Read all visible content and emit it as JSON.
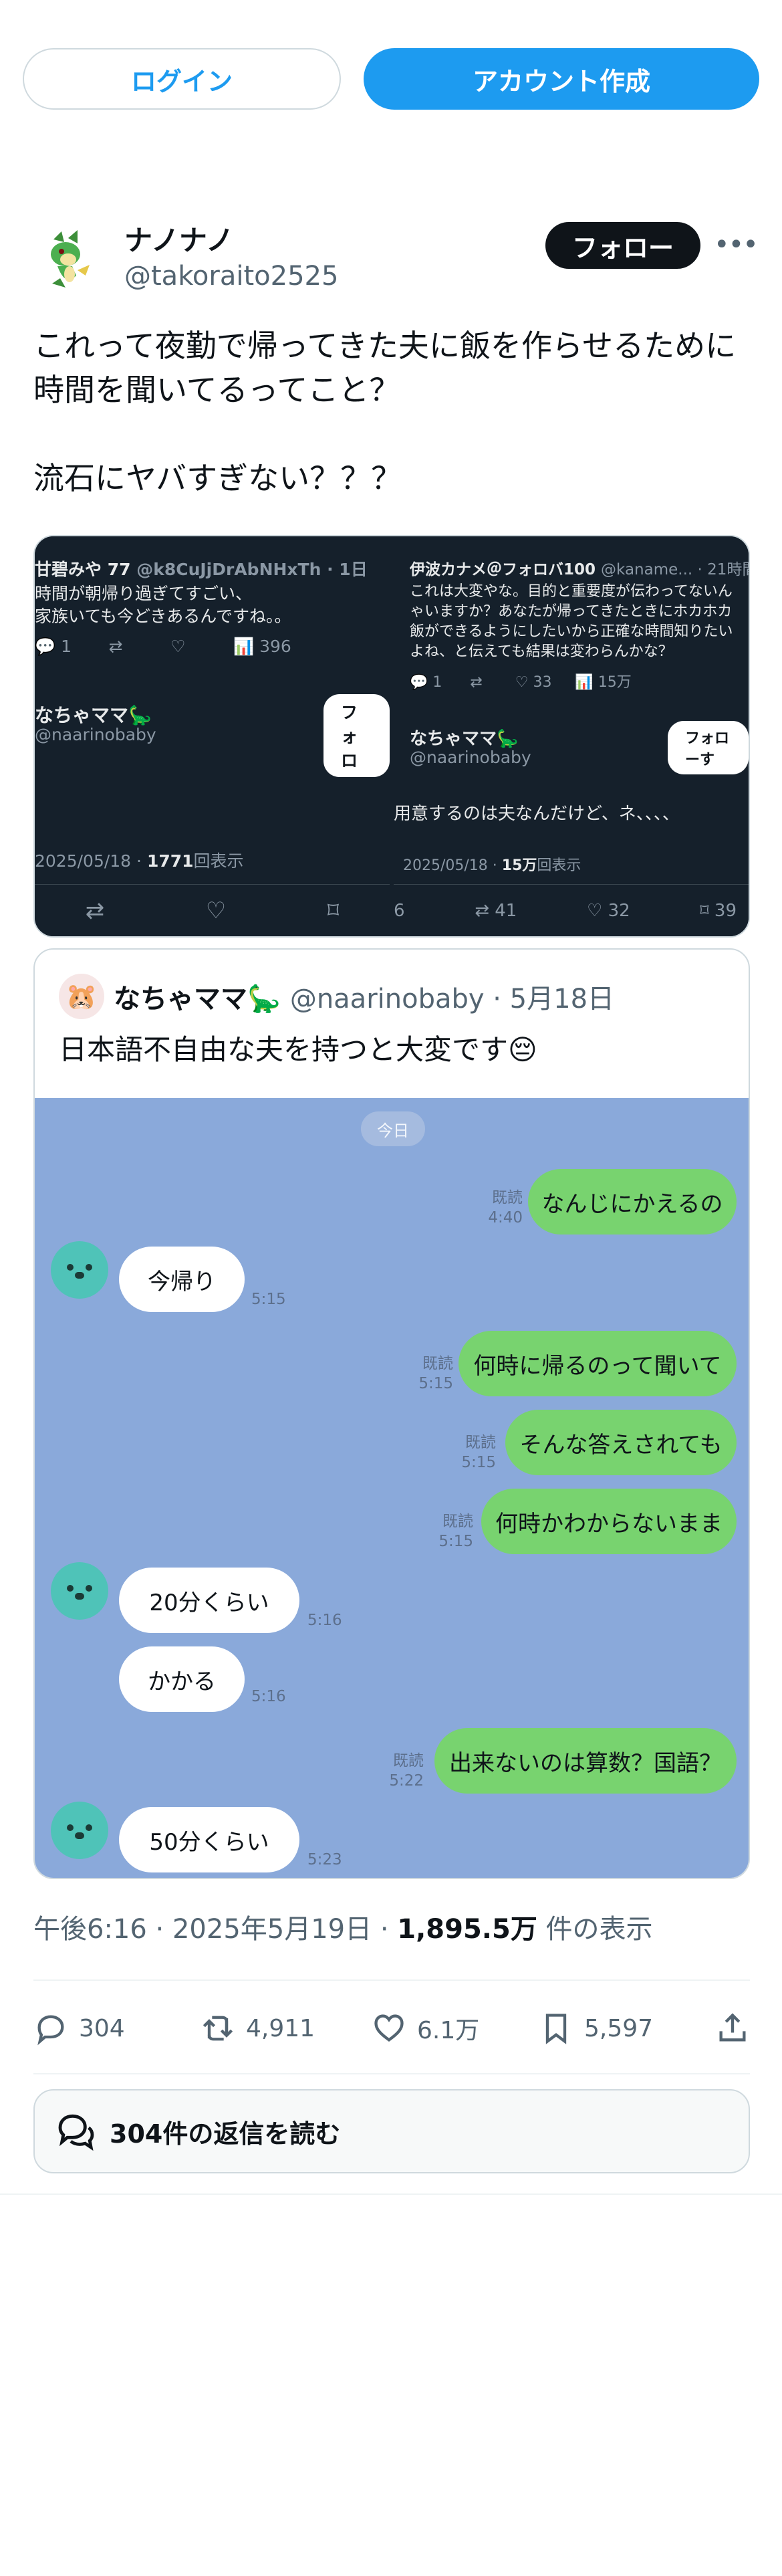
{
  "auth": {
    "login_label": "ログイン",
    "signup_label": "アカウント作成"
  },
  "author": {
    "name": "ナノナノ",
    "handle": "@takoraito2525",
    "follow_label": "フォロー",
    "more_icon": "more-horizontal-icon"
  },
  "tweet": {
    "text": "これって夜勤で帰ってきた夫に飯を作らせるために時間を聞いてるってこと？\n\n流石にヤバすぎない？？？"
  },
  "media": {
    "left": {
      "reply_author": "甘碧みや 77",
      "reply_handle": "@k8CuJjDrAbNHxTh · 1日",
      "reply_line1": "時間が朝帰り過ぎてすごい、",
      "reply_line2": "家族いても今どきあるんですね。。",
      "reply_likes": "1",
      "reply_views": "396",
      "post_author": "なちゃママ",
      "post_handle": "@naarinobaby",
      "follow_label": "フォロ",
      "date": "2025/05/18 · ",
      "views_bold": "1771",
      "views_suffix": "回表示"
    },
    "right": {
      "reply_author": "伊波カナメ＠フォロバ100",
      "reply_handle": "@kaname... · 21時間",
      "reply_line1": "これは大変やな。目的と重要度が伝わってないん",
      "reply_line2": "ゃいますか？あなたが帰ってきたときにホカホカ",
      "reply_line3": "飯ができるようにしたいから正確な時間知りたい",
      "reply_line4": "よね、と伝えても結果は変わらんかな？",
      "reply_replies": "1",
      "reply_likes": "33",
      "reply_views": "15万",
      "post_author": "なちゃママ",
      "post_handle": "@naarinobaby",
      "follow_label": "フォローす",
      "body": "用意するのは夫なんだけど、ネ、、、、",
      "date": "2025/05/18 · ",
      "views_bold": "15万",
      "views_suffix": "回表示",
      "retweets": "41",
      "likes": "32",
      "bookmarks": "39",
      "left_num": "6"
    }
  },
  "quote": {
    "name": "なちゃママ",
    "meta": "@naarinobaby · 5月18日",
    "text": "日本語不自由な夫を持つと大変です😔",
    "chat": {
      "date_pill": "今日",
      "messages": [
        {
          "text": "なんじにかえるの",
          "read": "既読",
          "time": "4:40"
        },
        {
          "text": "今帰り",
          "time": "5:15"
        },
        {
          "text": "何時に帰るのって聞いて",
          "read": "既読",
          "time": "5:15"
        },
        {
          "text": "そんな答えされても",
          "read": "既読",
          "time": "5:15"
        },
        {
          "text": "何時かわからないまま",
          "read": "既読",
          "time": "5:15"
        },
        {
          "text": "20分くらい",
          "time": "5:16"
        },
        {
          "text": "かかる",
          "time": "5:16"
        },
        {
          "text": "出来ないのは算数？国語？",
          "read": "既読",
          "time": "5:22"
        },
        {
          "text": "50分くらい",
          "time": "5:23"
        }
      ]
    }
  },
  "stamp": {
    "prefix": "午後6:16 · 2025年5月19日 · ",
    "views": "1,895.5万",
    "suffix": " 件の表示"
  },
  "actions": {
    "replies": "304",
    "retweets": "4,911",
    "likes": "6.1万",
    "bookmarks": "5,597"
  },
  "read_replies": {
    "label": "304件の返信を読む"
  },
  "colors": {
    "accent": "#1d9bf0",
    "line_green": "#78d36f",
    "chat_bg": "#8aa9da"
  }
}
